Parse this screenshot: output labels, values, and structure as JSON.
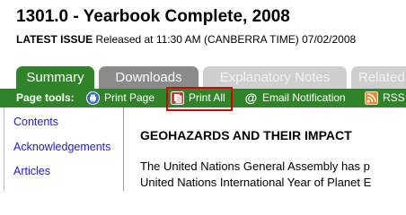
{
  "header": {
    "title": "1301.0 - Yearbook Complete, 2008",
    "latest_issue_label": "LATEST ISSUE",
    "release_text": "Released at 11:30 AM (CANBERRA TIME) 07/02/2008"
  },
  "tabs": [
    {
      "label": "Summary",
      "state": "active"
    },
    {
      "label": "Downloads",
      "state": "inactive"
    },
    {
      "label": "Explanatory Notes",
      "state": "disabled"
    },
    {
      "label": "Related In",
      "state": "disabled"
    }
  ],
  "page_tools": {
    "label": "Page tools:",
    "items": [
      {
        "label": "Print Page",
        "icon": "printer-icon"
      },
      {
        "label": "Print All",
        "icon": "print-all-icon"
      },
      {
        "label": "Email Notification",
        "icon": "at-sign-icon"
      },
      {
        "label": "RSS",
        "icon": "rss-icon"
      }
    ]
  },
  "sidebar": {
    "items": [
      {
        "label": "Contents"
      },
      {
        "label": "Acknowledgements"
      },
      {
        "label": "Articles"
      }
    ]
  },
  "main": {
    "heading": "GEOHAZARDS AND THEIR IMPACT",
    "paragraph_lines": [
      "The United Nations General Assembly has p",
      "United Nations International Year of Planet E"
    ]
  },
  "colors": {
    "tab_active": "#31832a",
    "tab_inactive": "#8b8b8b",
    "tab_disabled": "#cfcfcf",
    "link": "#1d1dd2",
    "highlight": "#d40000"
  }
}
